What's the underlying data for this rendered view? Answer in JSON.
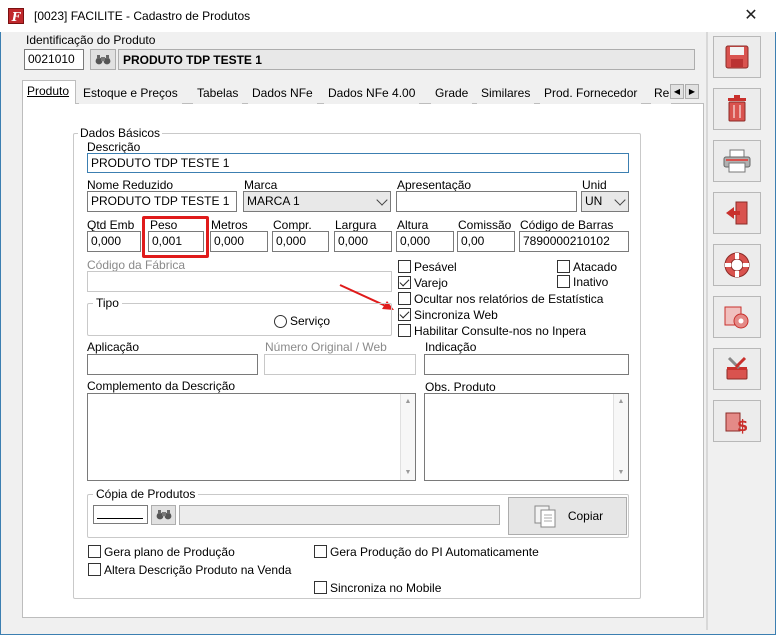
{
  "window": {
    "title": "[0023] FACILITE - Cadastro de Produtos"
  },
  "identificacao": {
    "label": "Identificação do Produto",
    "code": "0021010",
    "name": "PRODUTO TDP TESTE 1"
  },
  "tabs": [
    "Produto",
    "Estoque e Preços",
    "Tabelas",
    "Dados NFe",
    "Dados NFe 4.00",
    "Grade",
    "Similares",
    "Prod. Fornecedor",
    "Re"
  ],
  "dados_basicos": {
    "legend": "Dados Básicos",
    "descricao_label": "Descrição",
    "descricao": "PRODUTO TDP TESTE 1",
    "nome_reduzido_label": "Nome Reduzido",
    "nome_reduzido": "PRODUTO TDP TESTE 1",
    "marca_label": "Marca",
    "marca": "MARCA 1",
    "apresentacao_label": "Apresentação",
    "apresentacao": "",
    "unid_label": "Unid",
    "unid": "UN",
    "qtd_emb_label": "Qtd Emb",
    "qtd_emb": "0,000",
    "peso_label": "Peso",
    "peso": "0,001",
    "metros_label": "Metros",
    "metros": "0,000",
    "compr_label": "Compr.",
    "compr": "0,000",
    "largura_label": "Largura",
    "largura": "0,000",
    "altura_label": "Altura",
    "altura": "0,000",
    "comissao_label": "Comissão",
    "comissao": "0,00",
    "codigo_barras_label": "Código de Barras",
    "codigo_barras": "7890000210102",
    "codigo_fabrica_label": "Código da Fábrica",
    "tipo_legend": "Tipo",
    "servico_label": "Serviço",
    "aplicacao_label": "Aplicação",
    "numero_original_label": "Número Original / Web",
    "indicacao_label": "Indicação",
    "complemento_label": "Complemento da Descrição",
    "obs_label": "Obs. Produto",
    "copia_legend": "Cópia de Produtos",
    "copiar_label": "Copiar"
  },
  "checkboxes": {
    "pesavel": {
      "label": "Pesável",
      "checked": false
    },
    "atacado": {
      "label": "Atacado",
      "checked": false
    },
    "varejo": {
      "label": "Varejo",
      "checked": true
    },
    "inativo": {
      "label": "Inativo",
      "checked": false
    },
    "ocultar": {
      "label": "Ocultar nos relatórios de Estatística",
      "checked": false
    },
    "sincroniza_web": {
      "label": "Sincroniza Web",
      "checked": true
    },
    "consulte": {
      "label": "Habilitar Consulte-nos no Inpera",
      "checked": false
    },
    "gera_plano": {
      "label": "Gera plano de Produção",
      "checked": false
    },
    "gera_producao_pi": {
      "label": "Gera Produção do PI Automaticamente",
      "checked": false
    },
    "altera_descricao": {
      "label": "Altera Descrição Produto na Venda",
      "checked": false
    },
    "sincroniza_mobile": {
      "label": "Sincroniza no Mobile",
      "checked": false
    }
  },
  "toolbar_icons": [
    "save-icon",
    "trash-icon",
    "print-icon",
    "exit-icon",
    "help-icon",
    "gear-icon",
    "tools-icon",
    "price-icon"
  ]
}
